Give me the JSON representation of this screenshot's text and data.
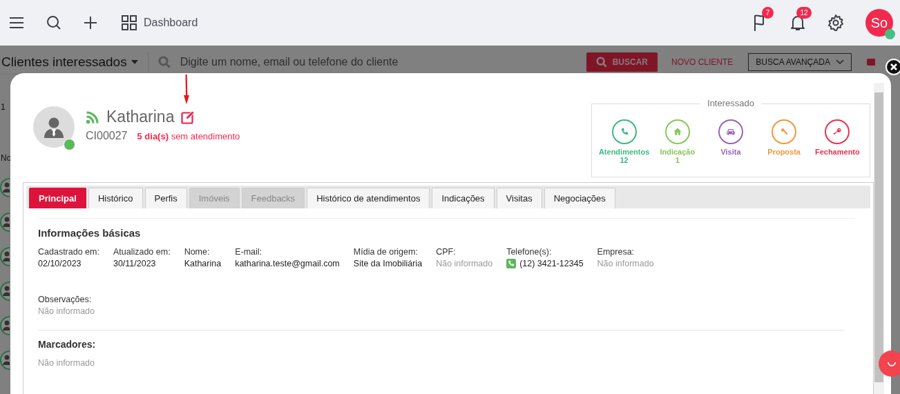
{
  "topbar": {
    "menu_label": "Dashboard",
    "flags_badge": "7",
    "notifications_badge": "12",
    "user_initials": "So",
    "user_online": true
  },
  "background": {
    "list_title": "Clientes interessados",
    "search_placeholder": "Digite um nome, email ou telefone do cliente",
    "search_button": "BUSCAR",
    "new_button": "NOVO CLIENTE",
    "advanced_button": "BUSCA AVANÇADA",
    "side_fragments": [
      "1",
      "No"
    ]
  },
  "client": {
    "name": "Katharina",
    "code": "CI00027",
    "status": "**5 dia(s)** sem atendimento",
    "online": true
  },
  "funnel": {
    "title": "Interessado",
    "stages": [
      {
        "kind": "phone",
        "label": "Atendimentos",
        "count": "12",
        "color": "#3dba7e"
      },
      {
        "kind": "home",
        "label": "Indicação",
        "count": "1",
        "color": "#86c75b"
      },
      {
        "kind": "car",
        "label": "Visita",
        "color": "#9b63b8"
      },
      {
        "kind": "gavel",
        "label": "Proposta",
        "color": "#f0973f"
      },
      {
        "kind": "key",
        "label": "Fechamento",
        "color": "#e8334f"
      }
    ]
  },
  "tabs": [
    {
      "label": "Principal",
      "selected": true,
      "disabled": false
    },
    {
      "label": "Histórico",
      "selected": false,
      "disabled": false
    },
    {
      "label": "Perfis",
      "selected": false,
      "disabled": false
    },
    {
      "label": "Imóveis",
      "selected": false,
      "disabled": true
    },
    {
      "label": "Feedbacks",
      "selected": false,
      "disabled": true
    },
    {
      "label": "Histórico de atendimentos",
      "selected": false,
      "disabled": false
    },
    {
      "label": "Indicações",
      "selected": false,
      "disabled": false
    },
    {
      "label": "Visitas",
      "selected": false,
      "disabled": false
    },
    {
      "label": "Negociações",
      "selected": false,
      "disabled": false
    }
  ],
  "basic_info": {
    "title": "Informações básicas",
    "fields": [
      {
        "label": "Cadastrado em:",
        "value": "02/10/2023",
        "kind": "text",
        "missing": false
      },
      {
        "label": "Atualizado em:",
        "value": "30/11/2023",
        "kind": "text",
        "missing": false
      },
      {
        "label": "Nome:",
        "value": "Katharina",
        "kind": "text",
        "missing": false
      },
      {
        "label": "E-mail:",
        "value": "katharina.teste@gmail.com",
        "kind": "text",
        "missing": false
      },
      {
        "label": "Mídia de origem:",
        "value": "Site da Imobiliária",
        "kind": "text",
        "missing": false
      },
      {
        "label": "CPF:",
        "value": "Não informado",
        "kind": "text",
        "missing": true
      },
      {
        "label": "Telefone(s):",
        "value": "(12) 3421-12345",
        "kind": "phone",
        "missing": false
      },
      {
        "label": "Empresa:",
        "value": "Não informado",
        "kind": "text",
        "missing": true
      }
    ],
    "notes": {
      "label": "Observações:",
      "value": "Não informado",
      "missing": true
    }
  },
  "tags": {
    "title": "Marcadores:",
    "value": "Não informado",
    "missing": true
  }
}
